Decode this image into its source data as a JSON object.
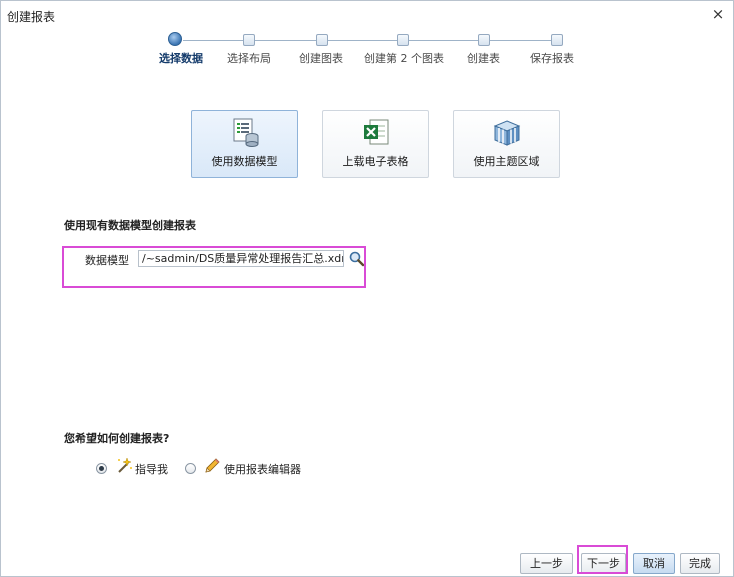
{
  "dialog": {
    "title": "创建报表",
    "close_symbol": "×"
  },
  "train": {
    "steps": [
      {
        "label": "选择数据",
        "active": true
      },
      {
        "label": "选择布局",
        "active": false
      },
      {
        "label": "创建图表",
        "active": false
      },
      {
        "label": "创建第 2 个图表",
        "active": false
      },
      {
        "label": "创建表",
        "active": false
      },
      {
        "label": "保存报表",
        "active": false
      }
    ]
  },
  "sources": {
    "items": [
      {
        "label": "使用数据模型",
        "icon": "data-model-icon",
        "selected": true
      },
      {
        "label": "上载电子表格",
        "icon": "spreadsheet-icon",
        "selected": false
      },
      {
        "label": "使用主题区域",
        "icon": "subject-area-icon",
        "selected": false
      }
    ]
  },
  "data_model": {
    "section_title": "使用现有数据模型创建报表",
    "field_label": "数据模型",
    "value": "/~sadmin/DS质量异常处理报告汇总.xdm",
    "search_icon": "search-icon"
  },
  "create_mode": {
    "question": "您希望如何创建报表?",
    "options": [
      {
        "label": "指导我",
        "icon": "magic-wand-icon",
        "checked": true
      },
      {
        "label": "使用报表编辑器",
        "icon": "pencil-icon",
        "checked": false
      }
    ]
  },
  "footer": {
    "back_label": "上一步",
    "next_label": "下一步",
    "cancel_label": "取消",
    "finish_label": "完成"
  },
  "colors": {
    "highlight": "#d94bd6",
    "accent": "#3a74b2",
    "excel_green": "#1d7a3c"
  }
}
